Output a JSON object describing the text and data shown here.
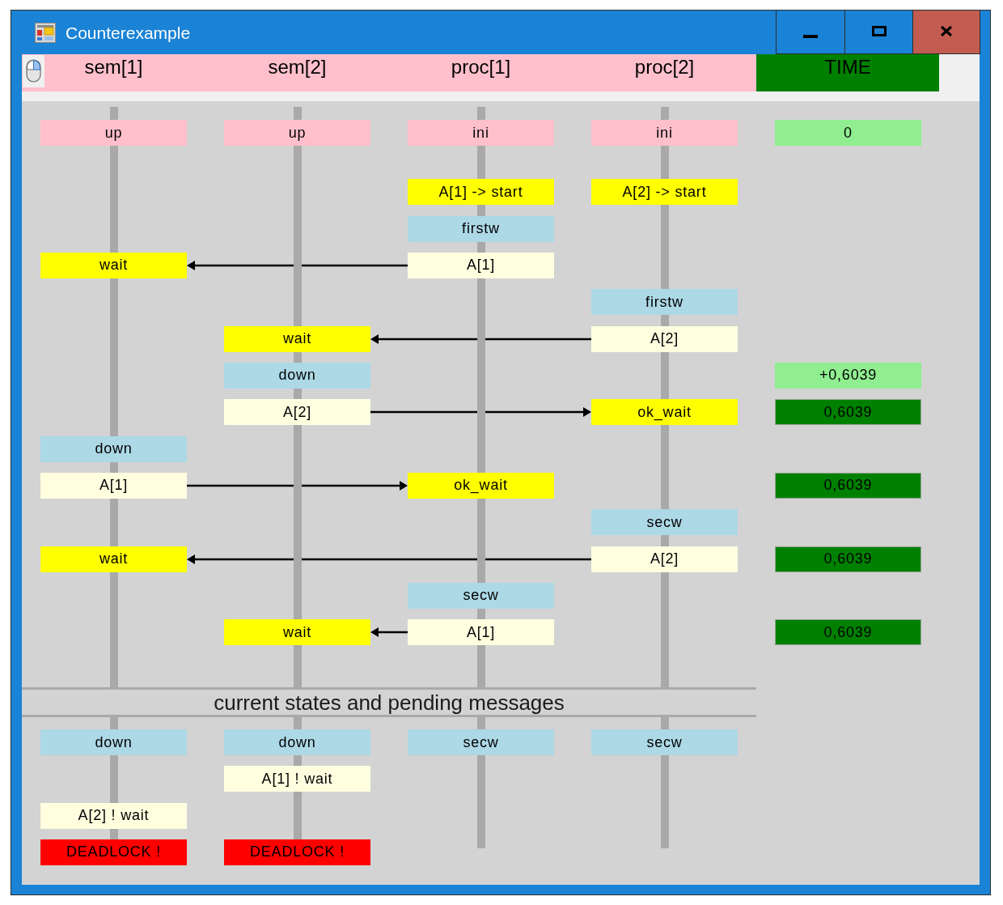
{
  "window": {
    "title": "Counterexample"
  },
  "header": {
    "sem_1": "sem[1]",
    "sem_2": "sem[2]",
    "proc_1": "proc[1]",
    "proc_2": "proc[2]",
    "time": "TIME"
  },
  "trace": {
    "rows": [
      {
        "sem_1": {
          "kind": "initial",
          "text": "up"
        },
        "sem_2": {
          "kind": "initial",
          "text": "up"
        },
        "proc_1": {
          "kind": "initial",
          "text": "ini"
        },
        "proc_2": {
          "kind": "initial",
          "text": "ini"
        },
        "time": {
          "kind": "delay",
          "text": "0"
        }
      },
      {
        "proc_1": {
          "kind": "event",
          "text": "A[1] -> start"
        },
        "proc_2": {
          "kind": "event",
          "text": "A[2] -> start"
        }
      },
      {
        "proc_1": {
          "kind": "state",
          "text": "firstw"
        }
      },
      {
        "sem_1": {
          "kind": "event",
          "text": "wait"
        },
        "proc_1": {
          "kind": "message",
          "text": "A[1]"
        },
        "arrow": true
      },
      {
        "proc_2": {
          "kind": "state",
          "text": "firstw"
        }
      },
      {
        "sem_2": {
          "kind": "event",
          "text": "wait"
        },
        "proc_2": {
          "kind": "message",
          "text": "A[2]"
        },
        "arrow": true
      },
      {
        "sem_2": {
          "kind": "state",
          "text": "down"
        },
        "time": {
          "kind": "delay",
          "text": "+0,6039"
        }
      },
      {
        "sem_2": {
          "kind": "message",
          "text": "A[2]"
        },
        "proc_2": {
          "kind": "event",
          "text": "ok_wait"
        },
        "arrow": true,
        "time": {
          "kind": "stamp",
          "text": "0,6039"
        }
      },
      {
        "sem_1": {
          "kind": "state",
          "text": "down"
        }
      },
      {
        "sem_1": {
          "kind": "message",
          "text": "A[1]"
        },
        "proc_1": {
          "kind": "event",
          "text": "ok_wait"
        },
        "arrow": true,
        "time": {
          "kind": "stamp",
          "text": "0,6039"
        }
      },
      {
        "proc_2": {
          "kind": "state",
          "text": "secw"
        }
      },
      {
        "sem_1": {
          "kind": "event",
          "text": "wait"
        },
        "proc_2": {
          "kind": "message",
          "text": "A[2]"
        },
        "arrow": true,
        "time": {
          "kind": "stamp",
          "text": "0,6039"
        }
      },
      {
        "proc_1": {
          "kind": "state",
          "text": "secw"
        }
      },
      {
        "sem_2": {
          "kind": "event",
          "text": "wait"
        },
        "proc_1": {
          "kind": "message",
          "text": "A[1]"
        },
        "arrow": true,
        "time": {
          "kind": "stamp",
          "text": "0,6039"
        }
      }
    ]
  },
  "current": {
    "title": "current states and pending messages",
    "rows": [
      {
        "sem_1": {
          "kind": "state",
          "text": "down"
        },
        "sem_2": {
          "kind": "state",
          "text": "down"
        },
        "proc_1": {
          "kind": "state",
          "text": "secw"
        },
        "proc_2": {
          "kind": "state",
          "text": "secw"
        }
      },
      {
        "sem_2": {
          "kind": "message",
          "text": "A[1] ! wait"
        }
      },
      {
        "sem_1": {
          "kind": "message",
          "text": "A[2] ! wait"
        }
      },
      {
        "sem_1": {
          "kind": "deadlock",
          "text": "DEADLOCK !"
        },
        "sem_2": {
          "kind": "deadlock",
          "text": "DEADLOCK !"
        }
      }
    ]
  }
}
